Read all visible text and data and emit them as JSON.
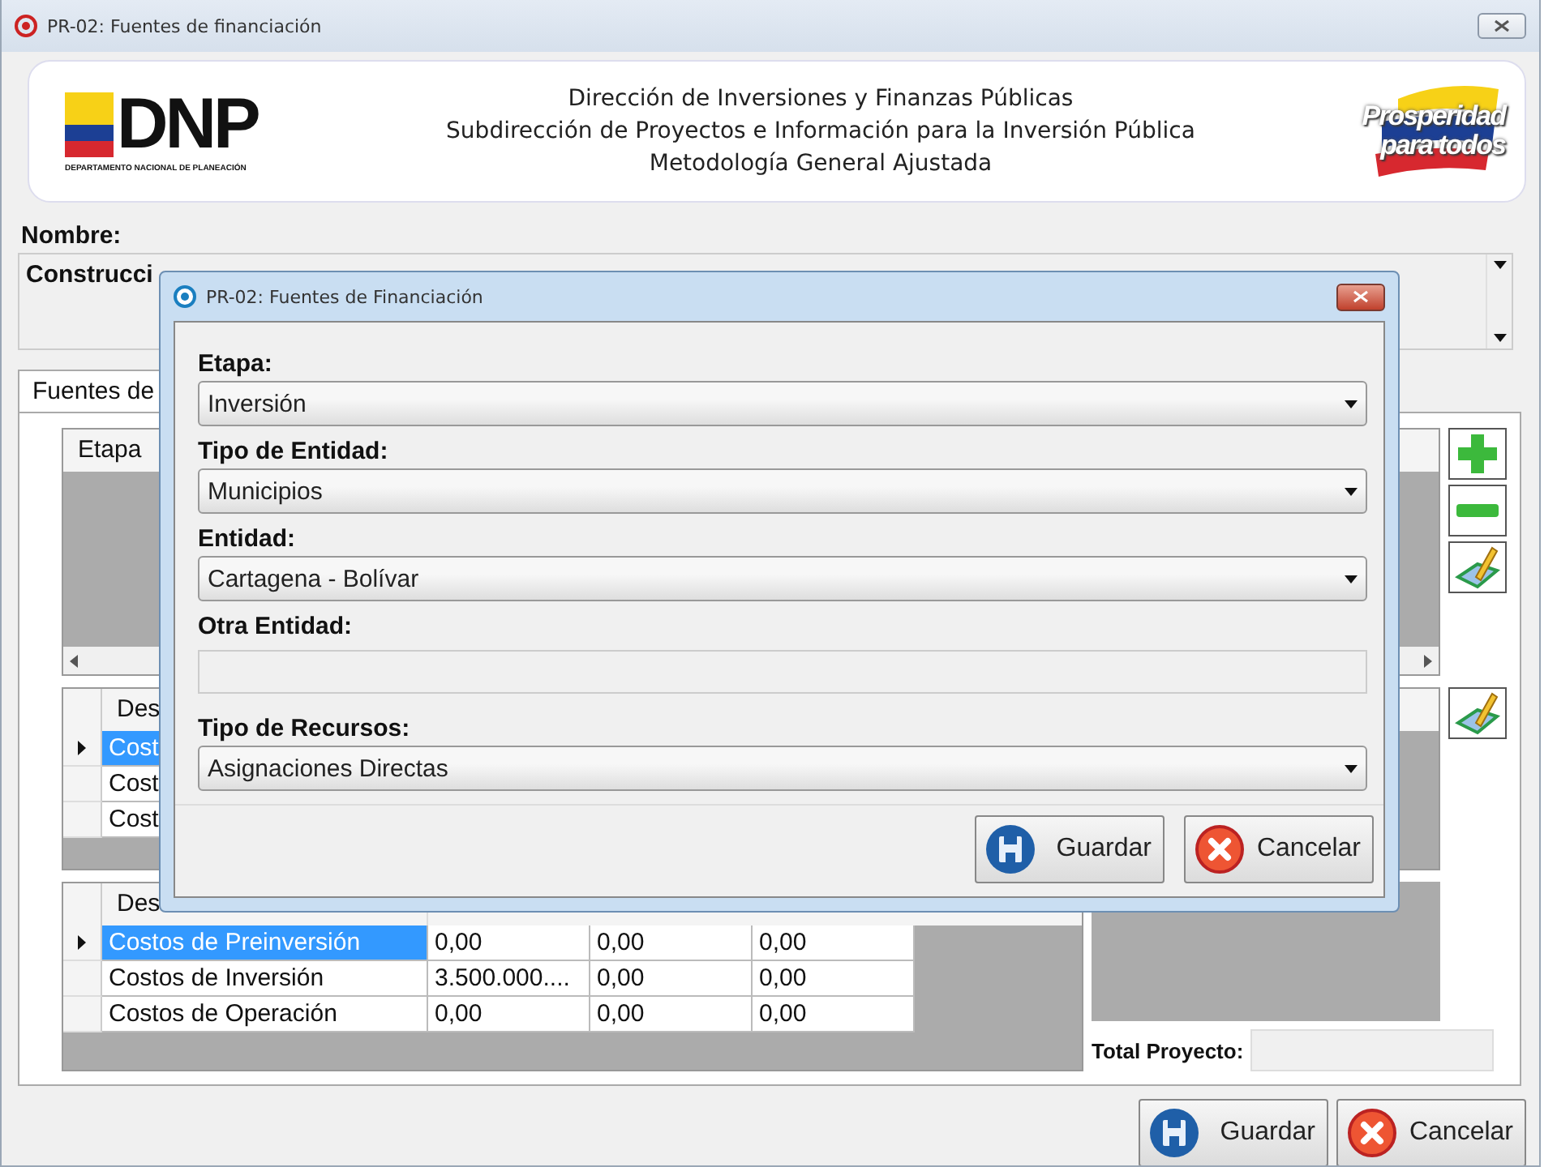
{
  "window": {
    "title": "PR-02: Fuentes de financiación"
  },
  "header": {
    "acronym": "DNP",
    "agency": "DEPARTAMENTO NACIONAL DE PLANEACIÓN",
    "lines": [
      "Dirección de Inversiones y Finanzas Públicas",
      "Subdirección de Proyectos e Información para la Inversión Pública",
      "Metodología General Ajustada"
    ],
    "slogan": [
      "Prosperidad",
      "para todos"
    ]
  },
  "nombre": {
    "label": "Nombre:",
    "value": "Construcci"
  },
  "tabs": [
    {
      "label": "Fuentes de",
      "selected": true
    }
  ],
  "grid_etapa": {
    "columns": [
      "Etapa"
    ]
  },
  "grid_costos": {
    "columns": [
      "Des"
    ],
    "rows": [
      {
        "cells": [
          "Cost"
        ],
        "selected": true
      },
      {
        "cells": [
          "Cost"
        ],
        "selected": false
      },
      {
        "cells": [
          "Cost"
        ],
        "selected": false
      }
    ]
  },
  "grid_totales": {
    "columns": [
      "Des"
    ],
    "rows": [
      {
        "cells": [
          "Costos de Preinversión",
          "0,00",
          "0,00",
          "0,00"
        ],
        "selected": true
      },
      {
        "cells": [
          "Costos de Inversión",
          "3.500.000....",
          "0,00",
          "0,00"
        ],
        "selected": false
      },
      {
        "cells": [
          "Costos de Operación",
          "0,00",
          "0,00",
          "0,00"
        ],
        "selected": false
      }
    ]
  },
  "total": {
    "label": "Total Proyecto:"
  },
  "buttons": [
    {
      "label": "Guardar",
      "kind": "save"
    },
    {
      "label": "Cancelar",
      "kind": "cancel"
    }
  ],
  "dialog": {
    "title": "PR-02: Fuentes de Financiación",
    "fields": [
      {
        "label": "Etapa:",
        "kind": "select",
        "value": "Inversión"
      },
      {
        "label": "Tipo de Entidad:",
        "kind": "select",
        "value": "Municipios"
      },
      {
        "label": "Entidad:",
        "kind": "select",
        "value": "Cartagena - Bolívar"
      },
      {
        "label": "Otra Entidad:",
        "kind": "text"
      },
      {
        "label": "Tipo de Recursos:",
        "kind": "select",
        "value": "Asignaciones Directas"
      }
    ],
    "buttons": [
      {
        "label": "Guardar",
        "kind": "save"
      },
      {
        "label": "Cancelar",
        "kind": "cancel"
      }
    ]
  }
}
